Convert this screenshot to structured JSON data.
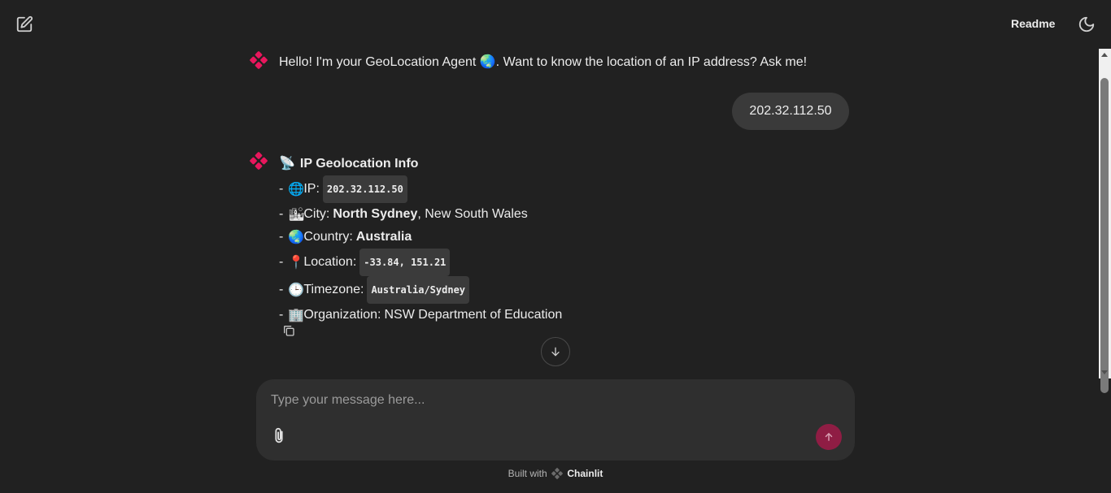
{
  "header": {
    "readme_label": "Readme",
    "new_chat_icon": "edit-icon",
    "theme_icon": "moon-icon"
  },
  "messages": {
    "welcome": "Hello! I'm your GeoLocation Agent 🌏. Want to know the location of an IP address? Ask me!",
    "user_query": "202.32.112.50",
    "info": {
      "title_icon": "📡",
      "title": "IP Geolocation Info",
      "ip_label": "IP:",
      "ip_value": "202.32.112.50",
      "city_label": "City:",
      "city_bold": "North Sydney",
      "city_rest": ", New South Wales",
      "country_label": "Country:",
      "country_value": "Australia",
      "location_label": "Location:",
      "location_value": "-33.84, 151.21",
      "timezone_label": "Timezone:",
      "timezone_value": "Australia/Sydney",
      "org_label": "Organization:",
      "org_value": "NSW Department of Education"
    }
  },
  "composer": {
    "placeholder": "Type your message here..."
  },
  "footer": {
    "prefix": "Built with",
    "brand": "Chainlit"
  },
  "colors": {
    "background": "#212121",
    "accent": "#e8175d",
    "send_button": "#8f1d44"
  }
}
